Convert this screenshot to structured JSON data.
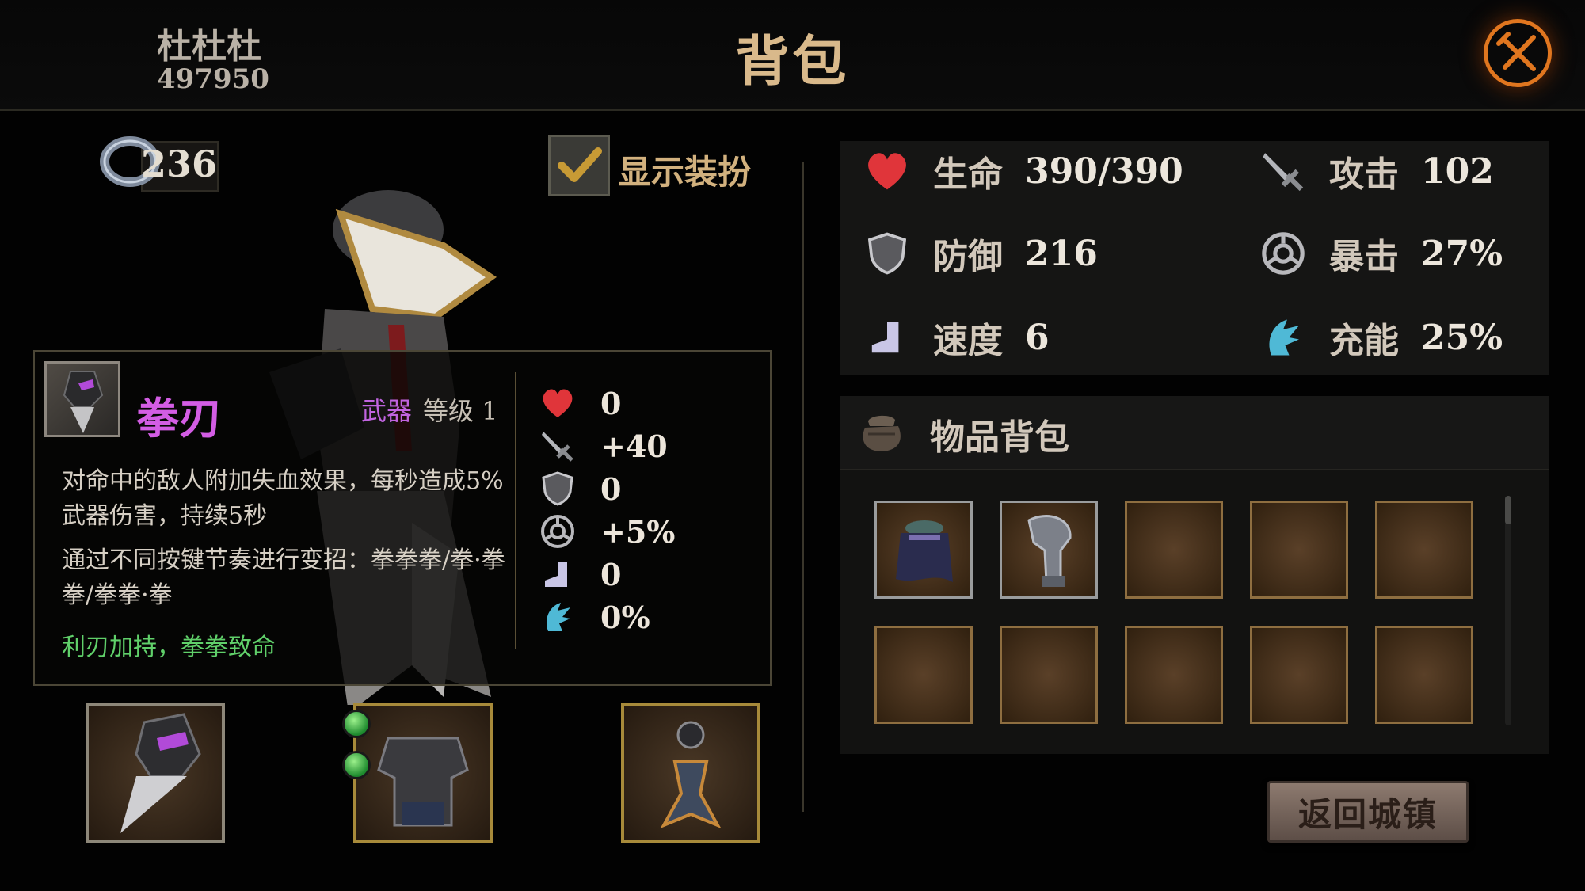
{
  "header": {
    "player_name": "杜杜杜",
    "player_id": "497950",
    "title": "背包"
  },
  "currency": {
    "gems": "236"
  },
  "costume_toggle": {
    "label": "显示装扮",
    "checked": true
  },
  "item_detail": {
    "name": "拳刃",
    "type": "武器",
    "level": "等级 1",
    "description_1": "对命中的敌人附加失血效果，每秒造成5%武器伤害，持续5秒",
    "description_2": "通过不同按键节奏进行变招：拳拳拳/拳·拳拳/拳拳·拳",
    "set_bonus": "利刃加持，拳拳致命",
    "stat_bonuses": [
      {
        "icon": "heart-icon",
        "value": "0"
      },
      {
        "icon": "sword-icon",
        "value": "+40"
      },
      {
        "icon": "shield-icon",
        "value": "0"
      },
      {
        "icon": "crit-icon",
        "value": "+5%"
      },
      {
        "icon": "boot-icon",
        "value": "0"
      },
      {
        "icon": "energy-icon",
        "value": "0%"
      }
    ]
  },
  "character_stats": [
    {
      "icon": "heart-icon",
      "label": "生命",
      "value": "390/390"
    },
    {
      "icon": "sword-icon",
      "label": "攻击",
      "value": "102"
    },
    {
      "icon": "shield-icon",
      "label": "防御",
      "value": "216"
    },
    {
      "icon": "crit-icon",
      "label": "暴击",
      "value": "27%"
    },
    {
      "icon": "boot-icon",
      "label": "速度",
      "value": "6"
    },
    {
      "icon": "energy-icon",
      "label": "充能",
      "value": "25%"
    }
  ],
  "inventory": {
    "title": "物品背包",
    "slots": [
      {
        "item": "cape"
      },
      {
        "item": "helmet"
      },
      {
        "item": ""
      },
      {
        "item": ""
      },
      {
        "item": ""
      },
      {
        "item": ""
      },
      {
        "item": ""
      },
      {
        "item": ""
      },
      {
        "item": ""
      },
      {
        "item": ""
      }
    ]
  },
  "equipment": {
    "weapon": "fist-blade",
    "armor": "chest-armor",
    "trinket": "amulet",
    "armor_sockets": 2
  },
  "buttons": {
    "return_town": "返回城镇"
  },
  "colors": {
    "title_gold": "#d9b98b",
    "item_purple": "#d35de4",
    "set_green": "#60d06a",
    "heart_red": "#e0353a",
    "energy_cyan": "#4fb9d6",
    "close_orange": "#e0761f"
  }
}
